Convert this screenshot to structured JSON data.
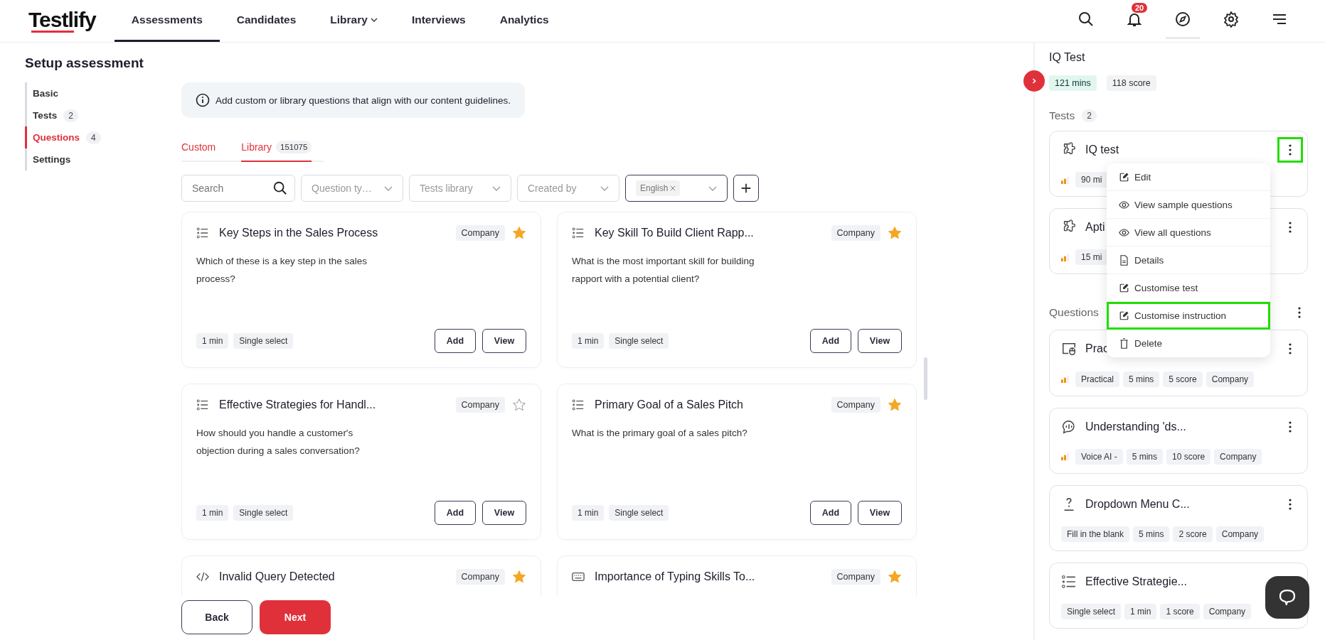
{
  "nav": {
    "logo": "Testlify",
    "items": [
      {
        "label": "Assessments",
        "selected": true,
        "dropdown": false
      },
      {
        "label": "Candidates",
        "selected": false,
        "dropdown": false
      },
      {
        "label": "Library",
        "selected": false,
        "dropdown": true
      },
      {
        "label": "Interviews",
        "selected": false,
        "dropdown": false
      },
      {
        "label": "Analytics",
        "selected": false,
        "dropdown": false
      }
    ],
    "icons": [
      {
        "kind": "search",
        "selected": false
      },
      {
        "kind": "bell",
        "selected": false,
        "badge": "20"
      },
      {
        "kind": "compass",
        "selected": true
      },
      {
        "kind": "gear",
        "selected": false
      },
      {
        "kind": "menu",
        "selected": false
      }
    ]
  },
  "setup": {
    "title": "Setup assessment",
    "steps": [
      {
        "label": "Basic",
        "selected": false
      },
      {
        "label": "Tests",
        "count": "2",
        "selected": false
      },
      {
        "label": "Questions",
        "count": "4",
        "selected": true
      },
      {
        "label": "Settings",
        "selected": false
      }
    ]
  },
  "info_banner": "Add custom or library questions that align with our content guidelines.",
  "tabs": [
    {
      "label": "Custom",
      "selected": false
    },
    {
      "label": "Library",
      "count": "151075",
      "selected": true
    }
  ],
  "filters": {
    "search_placeholder": "Search",
    "dropdowns": [
      "Question ty…",
      "Tests library",
      "Created by"
    ],
    "language_tag": "English"
  },
  "question_cards": [
    {
      "kind": "list",
      "title": "Key Steps in the Sales Process",
      "tag": "Company",
      "starred": true,
      "question": "Which of these is a key step in the sales process?",
      "chips": [
        "1 min",
        "Single select"
      ],
      "actions": [
        "Add",
        "View"
      ]
    },
    {
      "kind": "list",
      "title": "Key Skill To Build Client Rapp...",
      "tag": "Company",
      "starred": true,
      "question": "What is the most important skill for building rapport with a potential client?",
      "chips": [
        "1 min",
        "Single select"
      ],
      "actions": [
        "Add",
        "View"
      ]
    },
    {
      "kind": "list",
      "title": "Effective Strategies for Handl...",
      "tag": "Company",
      "starred": false,
      "question": "How should you handle a customer's objection during a sales conversation?",
      "chips": [
        "1 min",
        "Single select"
      ],
      "actions": [
        "Add",
        "View"
      ]
    },
    {
      "kind": "list",
      "title": "Primary Goal of a Sales Pitch",
      "tag": "Company",
      "starred": true,
      "question": "What is the primary goal of a sales pitch?",
      "chips": [
        "1 min",
        "Single select"
      ],
      "actions": [
        "Add",
        "View"
      ]
    },
    {
      "kind": "code",
      "title": "Invalid Query Detected",
      "tag": "Company",
      "starred": true
    },
    {
      "kind": "keyboard",
      "title": "Importance of Typing Skills To...",
      "tag": "Company",
      "starred": true
    }
  ],
  "footer": {
    "back": "Back",
    "next": "Next"
  },
  "panel": {
    "title": "IQ Test",
    "chips": [
      {
        "label": "121 mins",
        "kind": "time"
      },
      {
        "label": "118 score",
        "kind": "score"
      }
    ],
    "tests_label": "Tests",
    "tests_count": "2",
    "tests": [
      {
        "title": "IQ test",
        "difficulty": true,
        "chips": [
          "90 mi"
        ],
        "menu_open": true,
        "highlighted": true
      },
      {
        "title": "Apti",
        "difficulty": true,
        "chips": [
          "15 mi"
        ],
        "menu_open": false,
        "highlighted": false
      }
    ],
    "questions_label": "Questions",
    "questions": [
      {
        "kind": "practical",
        "title": "Prac",
        "difficulty": true,
        "chips": [
          "Practical",
          "5 mins",
          "5 score",
          "Company"
        ]
      },
      {
        "kind": "voice",
        "title": "Understanding 'ds...",
        "difficulty": true,
        "chips": [
          "Voice AI -",
          "5 mins",
          "10 score",
          "Company"
        ]
      },
      {
        "kind": "blank",
        "title": "Dropdown Menu C...",
        "difficulty": false,
        "chips": [
          "Fill in the blank",
          "5 mins",
          "2 score",
          "Company"
        ]
      },
      {
        "kind": "list",
        "title": "Effective Strategie...",
        "difficulty": false,
        "chips": [
          "Single select",
          "1 min",
          "1 score",
          "Company"
        ]
      }
    ]
  },
  "menu": {
    "items": [
      {
        "kind": "edit",
        "label": "Edit",
        "highlighted": false
      },
      {
        "kind": "eye",
        "label": "View sample questions",
        "highlighted": false
      },
      {
        "kind": "eye",
        "label": "View all questions",
        "highlighted": false
      },
      {
        "kind": "doc",
        "label": "Details",
        "highlighted": false
      },
      {
        "kind": "edit",
        "label": "Customise test",
        "highlighted": false
      },
      {
        "kind": "edit",
        "label": "Customise instruction",
        "highlighted": true
      },
      {
        "kind": "trash",
        "label": "Delete",
        "highlighted": false
      }
    ]
  }
}
